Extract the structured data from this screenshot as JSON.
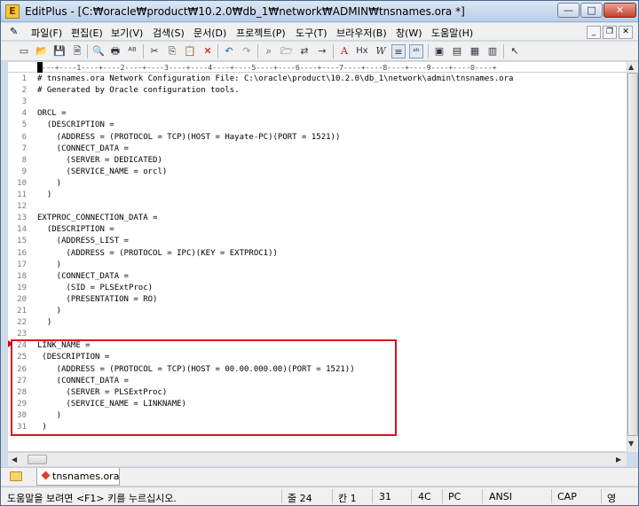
{
  "window": {
    "title": "EditPlus - [C:₩oracle₩product₩10.2.0₩db_1₩network₩ADMIN₩tnsnames.ora *]",
    "app_icon_glyph": "E",
    "min_glyph": "—",
    "max_glyph": "□",
    "close_glyph": "✕"
  },
  "menu": {
    "items": [
      "파일(F)",
      "편집(E)",
      "보기(V)",
      "검색(S)",
      "문서(D)",
      "프로젝트(P)",
      "도구(T)",
      "브라우저(B)",
      "창(W)",
      "도움말(H)"
    ],
    "mdi": [
      "_",
      "❐",
      "✕"
    ]
  },
  "toolbar": {
    "icons": [
      "new-file-icon",
      "open-folder-icon",
      "save-icon",
      "save-all-icon",
      "print-preview-icon",
      "print-icon",
      "spellcheck-icon",
      "cut-icon",
      "copy-icon",
      "paste-icon",
      "delete-icon",
      "undo-icon",
      "redo-icon",
      "find-icon",
      "find-in-files-icon",
      "replace-icon",
      "goto-line-icon",
      "font-size-icon",
      "hex-viewer-icon",
      "word-wrap-icon",
      "line-number-icon",
      "spell-icon",
      "browser-icon",
      "user-tool-icon",
      "cliptext-icon",
      "directory-icon",
      "help-pointer-icon"
    ],
    "glyphs": [
      "▭",
      "📂",
      "💾",
      "🗎",
      "🔍",
      "🖶",
      "ᴬᴮ",
      "✂",
      "⎘",
      "📋",
      "✕",
      "↶",
      "↷",
      "⌕",
      "🗁",
      "⇄",
      "→",
      "A",
      "Hx",
      "W",
      "≡",
      "ᵃᵇ",
      "▣",
      "▤",
      "▦",
      "▥",
      "↖"
    ]
  },
  "ruler": {
    "text": "----+----1----+----2----+----3----+----4----+----5----+----6----+----7----+----8----+----9----+----0----+"
  },
  "editor": {
    "lines": [
      {
        "n": "1",
        "text": "# tnsnames.ora Network Configuration File: C:\\oracle\\product\\10.2.0\\db_1\\network\\admin\\tnsnames.ora"
      },
      {
        "n": "2",
        "text": "# Generated by Oracle configuration tools."
      },
      {
        "n": "3",
        "text": ""
      },
      {
        "n": "4",
        "text": "ORCL ="
      },
      {
        "n": "5",
        "text": "  (DESCRIPTION ="
      },
      {
        "n": "6",
        "text": "    (ADDRESS = (PROTOCOL = TCP)(HOST = Hayate-PC)(PORT = 1521))"
      },
      {
        "n": "7",
        "text": "    (CONNECT_DATA ="
      },
      {
        "n": "8",
        "text": "      (SERVER = DEDICATED)"
      },
      {
        "n": "9",
        "text": "      (SERVICE_NAME = orcl)"
      },
      {
        "n": "10",
        "text": "    )"
      },
      {
        "n": "11",
        "text": "  )"
      },
      {
        "n": "12",
        "text": ""
      },
      {
        "n": "13",
        "text": "EXTPROC_CONNECTION_DATA ="
      },
      {
        "n": "14",
        "text": "  (DESCRIPTION ="
      },
      {
        "n": "15",
        "text": "    (ADDRESS_LIST ="
      },
      {
        "n": "16",
        "text": "      (ADDRESS = (PROTOCOL = IPC)(KEY = EXTPROC1))"
      },
      {
        "n": "17",
        "text": "    )"
      },
      {
        "n": "18",
        "text": "    (CONNECT_DATA ="
      },
      {
        "n": "19",
        "text": "      (SID = PLSExtProc)"
      },
      {
        "n": "20",
        "text": "      (PRESENTATION = RO)"
      },
      {
        "n": "21",
        "text": "    )"
      },
      {
        "n": "22",
        "text": "  )"
      },
      {
        "n": "23",
        "text": ""
      },
      {
        "n": "24",
        "text": "LINK_NAME ="
      },
      {
        "n": "25",
        "text": " (DESCRIPTION ="
      },
      {
        "n": "26",
        "text": "    (ADDRESS = (PROTOCOL = TCP)(HOST = 00.00.000.00)(PORT = 1521))"
      },
      {
        "n": "27",
        "text": "    (CONNECT_DATA ="
      },
      {
        "n": "28",
        "text": "      (SERVER = PLSExtProc)"
      },
      {
        "n": "29",
        "text": "      (SERVICE_NAME = LINKNAME)"
      },
      {
        "n": "30",
        "text": "    )"
      },
      {
        "n": "31",
        "text": " )"
      }
    ]
  },
  "tabs": {
    "active": "tnsnames.ora"
  },
  "status": {
    "hint": "도움말을 보려면 <F1> 키를 누르십시오.",
    "line": "줄 24",
    "col": "칸 1",
    "total": "31",
    "code": "4C",
    "pc": "PC",
    "encoding": "ANSI",
    "caps": "CAP",
    "ime": "영"
  },
  "colors": {
    "highlight_border": "#d9111b",
    "title_bar": "#c7d7ec"
  }
}
